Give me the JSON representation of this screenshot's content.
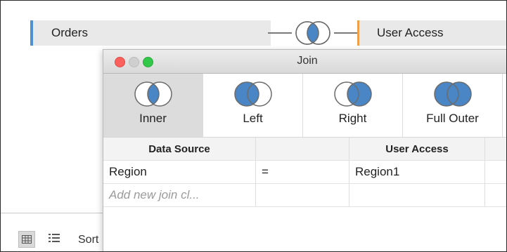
{
  "canvas": {
    "left_table": "Orders",
    "right_table": "User Access"
  },
  "dialog": {
    "title": "Join",
    "join_types": [
      {
        "label": "Inner",
        "selected": true
      },
      {
        "label": "Left",
        "selected": false
      },
      {
        "label": "Right",
        "selected": false
      },
      {
        "label": "Full Outer",
        "selected": false
      }
    ],
    "clauses": {
      "headers": [
        "Data Source",
        "",
        "User Access",
        ""
      ],
      "rows": [
        {
          "left": "Region",
          "operator": "=",
          "right": "Region1"
        }
      ],
      "add_placeholder": "Add new join cl..."
    }
  },
  "bottom_bar": {
    "sort_label": "Sort"
  },
  "colors": {
    "venn_fill": "#4a86c5",
    "orders_accent": "#4f8fd3",
    "user_access_accent": "#f0a04b"
  }
}
